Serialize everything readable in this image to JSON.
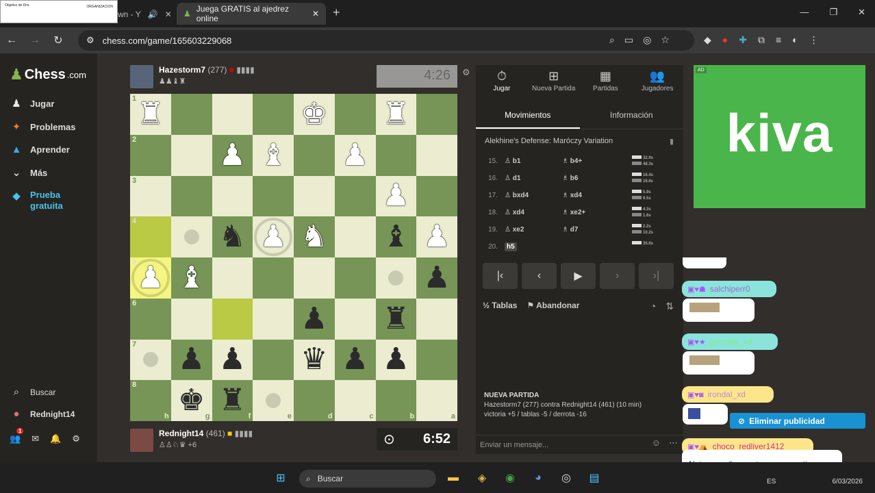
{
  "browser": {
    "thumb_title": "Objetivo de Dns",
    "thumb_sub": "ORGANIZACION",
    "tab1_label": "wn - Y",
    "tab2_label": "Juega GRATIS al ajedrez online",
    "url": "chess.com/game/165603229068"
  },
  "sidebar": {
    "logo_text": "Chess",
    "logo_suffix": ".com",
    "items": [
      {
        "label": "Jugar",
        "icon": "pawn-icon"
      },
      {
        "label": "Problemas",
        "icon": "puzzle-icon"
      },
      {
        "label": "Aprender",
        "icon": "cap-icon"
      },
      {
        "label": "Más",
        "icon": "chevron-down-icon"
      },
      {
        "label": "Prueba gratuita",
        "icon": "diamond-icon"
      }
    ],
    "search_label": "Buscar",
    "user_label": "Rednight14",
    "notif_count": "1"
  },
  "game": {
    "top_player": {
      "name": "Hazestorm7",
      "rating": "(277)"
    },
    "bottom_player": {
      "name": "Rednight14",
      "rating": "(461)",
      "captured_extra": "+6"
    },
    "top_clock": "4:26",
    "bottom_clock": "6:52",
    "files": [
      "h",
      "g",
      "f",
      "e",
      "d",
      "c",
      "b",
      "a"
    ],
    "ranks": [
      "1",
      "2",
      "3",
      "4",
      "5",
      "6",
      "7",
      "8"
    ]
  },
  "panel": {
    "tabs": [
      {
        "label": "Jugar",
        "icon": "clock-icon"
      },
      {
        "label": "Nueva Partida",
        "icon": "plus-icon"
      },
      {
        "label": "Partidas",
        "icon": "board-icon"
      },
      {
        "label": "Jugadores",
        "icon": "people-icon"
      }
    ],
    "subtabs": [
      "Movimientos",
      "Información"
    ],
    "opening": "Alekhine's Defense: Maróczy Variation",
    "moves": [
      {
        "n": "15.",
        "w": "b1",
        "b": "b4+",
        "tw": "32.9s",
        "tb": "48.3s"
      },
      {
        "n": "16.",
        "w": "d1",
        "b": "b6",
        "tw": "16.4s",
        "tb": "18.6s"
      },
      {
        "n": "17.",
        "w": "bxd4",
        "b": "xd4",
        "tw": "5.9s",
        "tb": "9.5s"
      },
      {
        "n": "18.",
        "w": "xd4",
        "b": "xe2+",
        "tw": "4.3s",
        "tb": "1.6s"
      },
      {
        "n": "19.",
        "w": "xe2",
        "b": "d7",
        "tw": "2.2s",
        "tb": "10.2s"
      },
      {
        "n": "20.",
        "w": "h5",
        "b": "",
        "tw": "35.6s",
        "tb": ""
      }
    ],
    "draw_label": "Tablas",
    "resign_label": "Abandonar",
    "new_game_title": "NUEVA PARTIDA",
    "new_game_line": "Hazestorm7 (277) contra Rednight14 (461) (10 min)",
    "new_game_score": "victoria +5 / tablas -5 / derrota -16",
    "chat_placeholder": "Enviar un mensaje..."
  },
  "ad": {
    "tag": "AD",
    "brand": "kiva",
    "remove_label": "Eliminar publicidad"
  },
  "stream_chat": [
    {
      "user": "salchiperr0"
    },
    {
      "user": "gonzalo_xd"
    },
    {
      "user": "irondal_xd"
    },
    {
      "user": "choco_redliver1412",
      "message": "Not gonna lie - no te voy a mentir"
    }
  ],
  "taskbar": {
    "search": "Buscar",
    "lang": "ES",
    "date": "6/03/2026"
  },
  "colors": {
    "light": "#ebecd0",
    "dark": "#779556",
    "highlight": "#baca44",
    "accent": "#81b64c"
  }
}
